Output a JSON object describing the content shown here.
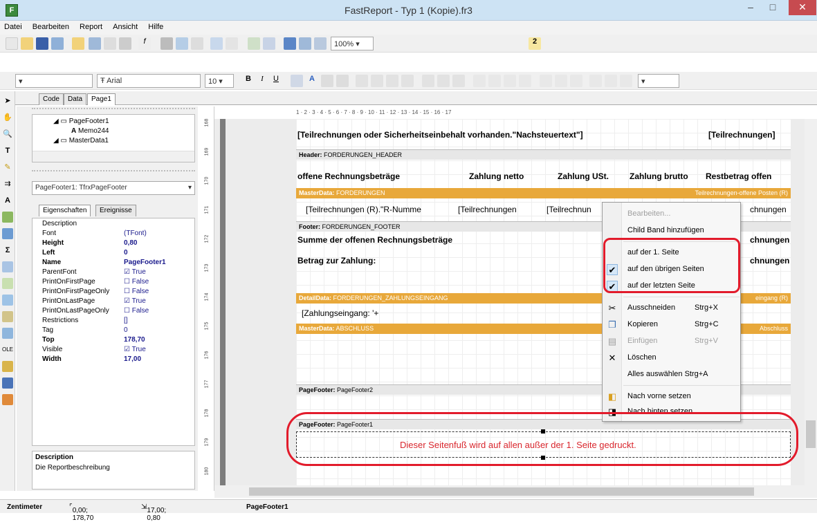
{
  "window": {
    "title": "FastReport - Typ 1 (Kopie).fr3",
    "min": "–",
    "max": "□",
    "close": "✕"
  },
  "menu": [
    "Datei",
    "Bearbeiten",
    "Report",
    "Ansicht",
    "Hilfe"
  ],
  "toolbar": {
    "zoom": "100%",
    "font": "Arial",
    "font_size": "10",
    "bold": "B",
    "italic": "I",
    "underline": "U"
  },
  "tabs": [
    "Code",
    "Data",
    "Page1"
  ],
  "tree": {
    "items": [
      "PageFooter1",
      "Memo244",
      "MasterData1"
    ]
  },
  "object_selector": "PageFooter1: TfrxPageFooter",
  "inspector_tabs": [
    "Eigenschaften",
    "Ereignisse"
  ],
  "properties": [
    {
      "name": "Description",
      "value": ""
    },
    {
      "name": "Font",
      "value": "(TFont)"
    },
    {
      "name": "Height",
      "value": "0,80"
    },
    {
      "name": "Left",
      "value": "0"
    },
    {
      "name": "Name",
      "value": "PageFooter1"
    },
    {
      "name": "ParentFont",
      "value": "True"
    },
    {
      "name": "PrintOnFirstPage",
      "value": "False"
    },
    {
      "name": "PrintOnFirstPageOnly",
      "value": "False"
    },
    {
      "name": "PrintOnLastPage",
      "value": "True"
    },
    {
      "name": "PrintOnLastPageOnly",
      "value": "False"
    },
    {
      "name": "Restrictions",
      "value": "[]"
    },
    {
      "name": "Tag",
      "value": "0"
    },
    {
      "name": "Top",
      "value": "178,70"
    },
    {
      "name": "Visible",
      "value": "True"
    },
    {
      "name": "Width",
      "value": "17,00"
    }
  ],
  "description": {
    "title": "Description",
    "text": "Die Reportbeschreibung"
  },
  "ruler_h": "1 · 2 · 3 · 4 · 5 · 6 · 7 · 8 · 9 · 10 · 11 · 12 · 13 · 14 · 15 · 16 · 17",
  "ruler_v": [
    "168",
    "169",
    "170",
    "171",
    "172",
    "173",
    "174",
    "175",
    "176",
    "177",
    "178",
    "179",
    "180"
  ],
  "report": {
    "top_text": "[Teilrechnungen oder Sicherheitseinbehalt vorhanden.\"Nachsteuertext\"]",
    "top_right": "[Teilrechnungen]",
    "header_label": "Header:",
    "header_name": "FORDERUNGEN_HEADER",
    "col1": "offene Rechnungsbeträge",
    "col2": "Zahlung netto",
    "col3": "Zahlung USt.",
    "col4": "Zahlung brutto",
    "col5": "Restbetrag offen",
    "md_label": "MasterData:",
    "md_name": "FORDERUNGEN",
    "md_right": "Teilrechnungen-offene Posten (R)",
    "md_row1": "[Teilrechnungen (R).\"R-Numme",
    "md_row2": "[Teilrechnungen",
    "md_row3": "[Teilrechnun",
    "md_row4": "chnungen",
    "footer_label": "Footer:",
    "footer_name": "FORDERUNGEN_FOOTER",
    "sum_text": "Summe der offenen Rechnungsbeträge",
    "pay_text": "Betrag zur Zahlung:",
    "right_trunc": "chnungen",
    "dd_label": "DetailData:",
    "dd_name": "FORDERUNGEN_ZAHLUNGSEINGANG",
    "dd_right": "eingang (R)",
    "dd_row": "[Zahlungseingang: '+",
    "md2_label": "MasterData:",
    "md2_name": "ABSCHLUSS",
    "md2_right": "Abschluss",
    "pf2_label": "PageFooter:",
    "pf2_name": "PageFooter2",
    "pf1_label": "PageFooter:",
    "pf1_name": "PageFooter1",
    "pf1_text": "Dieser Seitenfuß wird auf allen außer der 1. Seite gedruckt."
  },
  "context_menu": {
    "items": [
      {
        "label": "Bearbeiten...",
        "disabled": true
      },
      {
        "label": "Child Band hinzufügen"
      },
      {
        "label": "auf der 1. Seite"
      },
      {
        "label": "auf den übrigen Seiten",
        "checked": true
      },
      {
        "label": "auf der letzten Seite",
        "checked": true
      },
      {
        "label": "Ausschneiden",
        "shortcut": "Strg+X"
      },
      {
        "label": "Kopieren",
        "shortcut": "Strg+C"
      },
      {
        "label": "Einfügen",
        "shortcut": "Strg+V",
        "disabled": true
      },
      {
        "label": "Löschen"
      },
      {
        "label": "Alles auswählen",
        "shortcut": "Strg+A"
      },
      {
        "label": "Nach vorne setzen"
      },
      {
        "label": "Nach hinten setzen"
      }
    ]
  },
  "status": {
    "unit": "Zentimeter",
    "pos": "0,00; 178,70",
    "size": "17,00; 0,80",
    "object": "PageFooter1"
  },
  "colors": {
    "band_orange": "#e8a83a",
    "highlight_red": "#e21b2b",
    "pf_text_red": "#d9262d"
  }
}
